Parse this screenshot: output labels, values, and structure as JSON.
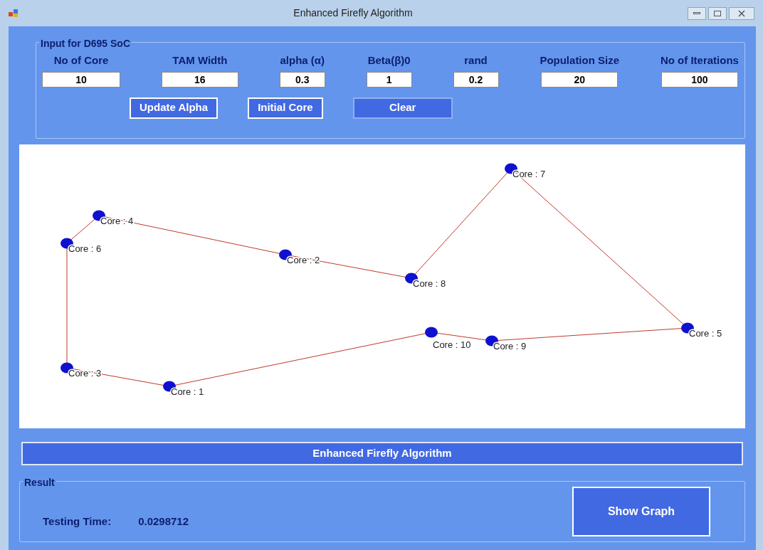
{
  "window": {
    "title": "Enhanced Firefly Algorithm"
  },
  "input_group": {
    "title": "Input for D695 SoC",
    "fields": [
      {
        "label": "No of Core",
        "value": "10"
      },
      {
        "label": "TAM Width",
        "value": "16"
      },
      {
        "label": "alpha (α)",
        "value": "0.3"
      },
      {
        "label": "Beta(β)0",
        "value": "1"
      },
      {
        "label": "rand",
        "value": "0.2"
      },
      {
        "label": "Population Size",
        "value": "20"
      },
      {
        "label": "No of Iterations",
        "value": "100"
      }
    ],
    "buttons": [
      "Update Alpha",
      "Initial Core",
      "Clear"
    ]
  },
  "graph": {
    "nodes": [
      "Core : 6",
      "Core : 4",
      "Core : 2",
      "Core : 8",
      "Core : 7",
      "Core : 5",
      "Core : 9",
      "Core : 10",
      "Core : 1",
      "Core : 3"
    ]
  },
  "run_button": "Enhanced Firefly Algorithm",
  "result_group": {
    "title": "Result",
    "label": "Testing Time:",
    "value": "0.0298712",
    "button": "Show Graph"
  }
}
